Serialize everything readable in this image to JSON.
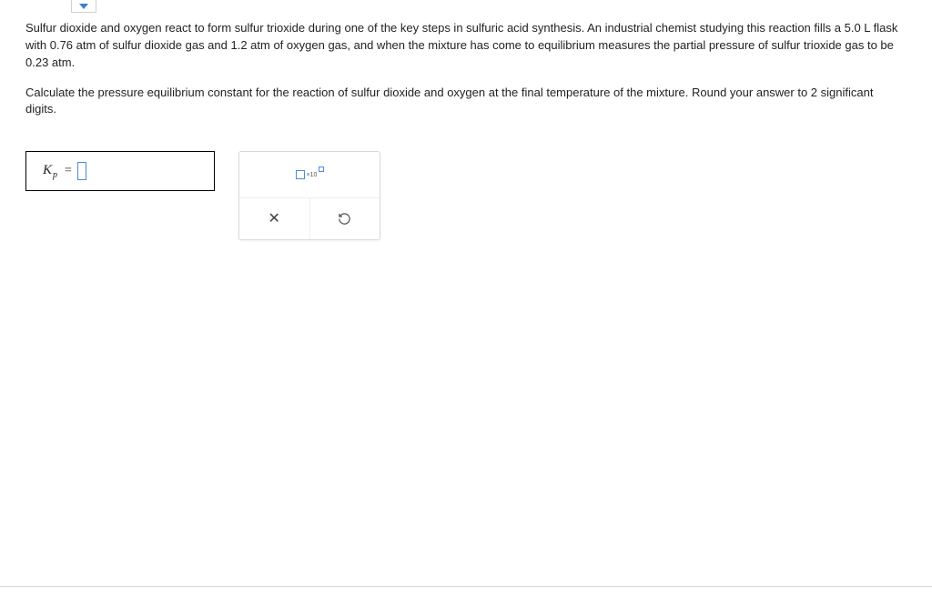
{
  "problem": {
    "paragraph1_a": "Sulfur dioxide and oxygen react to form sulfur trioxide during one of the key steps in sulfuric acid synthesis. An industrial chemist studying this reaction fills a ",
    "vol": "5.0 L",
    "paragraph1_b": " flask with ",
    "p_so2": "0.76 atm",
    "paragraph1_c": " of sulfur dioxide gas and ",
    "p_o2": "1.2 atm",
    "paragraph1_d": " of oxygen gas, and when the mixture has come to equilibrium measures the partial pressure of sulfur trioxide gas to be ",
    "p_so3": "0.23 atm",
    "paragraph1_e": ".",
    "paragraph2": "Calculate the pressure equilibrium constant for the reaction of sulfur dioxide and oxygen at the final temperature of the mixture. Round your answer to 2 significant digits."
  },
  "answer": {
    "symbol": "K",
    "subscript": "p",
    "equals": "="
  },
  "tools": {
    "sci_label": "×10",
    "clear_label": "✕"
  }
}
